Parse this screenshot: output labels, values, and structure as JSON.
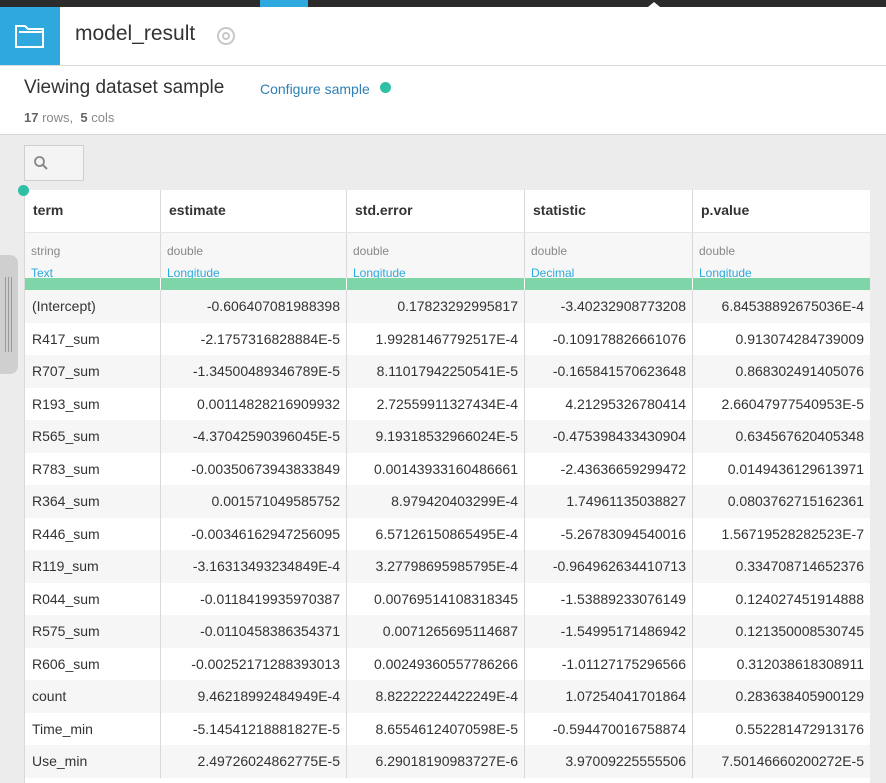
{
  "header": {
    "dataset_name": "model_result",
    "icon": "folder-icon",
    "name_icon": "compass-icon"
  },
  "subheader": {
    "title": "Viewing dataset sample",
    "configure_label": "Configure sample",
    "rows_count": "17",
    "rows_label": "rows,",
    "cols_count": "5",
    "cols_label": "cols"
  },
  "search": {
    "icon": "search-icon",
    "value": ""
  },
  "columns": [
    {
      "name": "term",
      "type": "string",
      "meaning": "Text"
    },
    {
      "name": "estimate",
      "type": "double",
      "meaning": "Longitude"
    },
    {
      "name": "std.error",
      "type": "double",
      "meaning": "Longitude"
    },
    {
      "name": "statistic",
      "type": "double",
      "meaning": "Decimal"
    },
    {
      "name": "p.value",
      "type": "double",
      "meaning": "Longitude"
    }
  ],
  "rows": [
    [
      "(Intercept)",
      "-0.606407081988398",
      "0.17823292995817",
      "-3.40232908773208",
      "6.84538892675036E-4"
    ],
    [
      "R417_sum",
      "-2.1757316828884E-5",
      "1.99281467792517E-4",
      "-0.109178826661076",
      "0.913074284739009"
    ],
    [
      "R707_sum",
      "-1.34500489346789E-5",
      "8.11017942250541E-5",
      "-0.165841570623648",
      "0.868302491405076"
    ],
    [
      "R193_sum",
      "0.00114828216909932",
      "2.72559911327434E-4",
      "4.21295326780414",
      "2.66047977540953E-5"
    ],
    [
      "R565_sum",
      "-4.37042590396045E-5",
      "9.19318532966024E-5",
      "-0.475398433430904",
      "0.634567620405348"
    ],
    [
      "R783_sum",
      "-0.00350673943833849",
      "0.00143933160486661",
      "-2.43636659299472",
      "0.0149436129613971"
    ],
    [
      "R364_sum",
      "0.001571049585752",
      "8.979420403299E-4",
      "1.74961135038827",
      "0.0803762715162361"
    ],
    [
      "R446_sum",
      "-0.00346162947256095",
      "6.57126150865495E-4",
      "-5.26783094540016",
      "1.56719528282523E-7"
    ],
    [
      "R119_sum",
      "-3.16313493234849E-4",
      "3.27798695985795E-4",
      "-0.964962634410713",
      "0.334708714652376"
    ],
    [
      "R044_sum",
      "-0.0118419935970387",
      "0.00769514108318345",
      "-1.53889233076149",
      "0.124027451914888"
    ],
    [
      "R575_sum",
      "-0.0110458386354371",
      "0.0071265695114687",
      "-1.54995171486942",
      "0.121350008530745"
    ],
    [
      "R606_sum",
      "-0.00252171288393013",
      "0.00249360557786266",
      "-1.01127175296566",
      "0.312038618308911"
    ],
    [
      "count",
      "9.46218992484949E-4",
      "8.82222224422249E-4",
      "1.07254041701864",
      "0.283638405900129"
    ],
    [
      "Time_min",
      "-5.14541218881827E-5",
      "8.65546124070598E-5",
      "-0.594470016758874",
      "0.552281472913176"
    ],
    [
      "Use_min",
      "2.49726024862775E-5",
      "6.29018190983727E-6",
      "3.97009225555506",
      "7.50146660200272E-5"
    ]
  ],
  "colors": {
    "accent": "#2ea8dd",
    "link": "#2d7fb5",
    "status_dot": "#2fbfa5",
    "valid_bar": "#7ed6a8"
  }
}
